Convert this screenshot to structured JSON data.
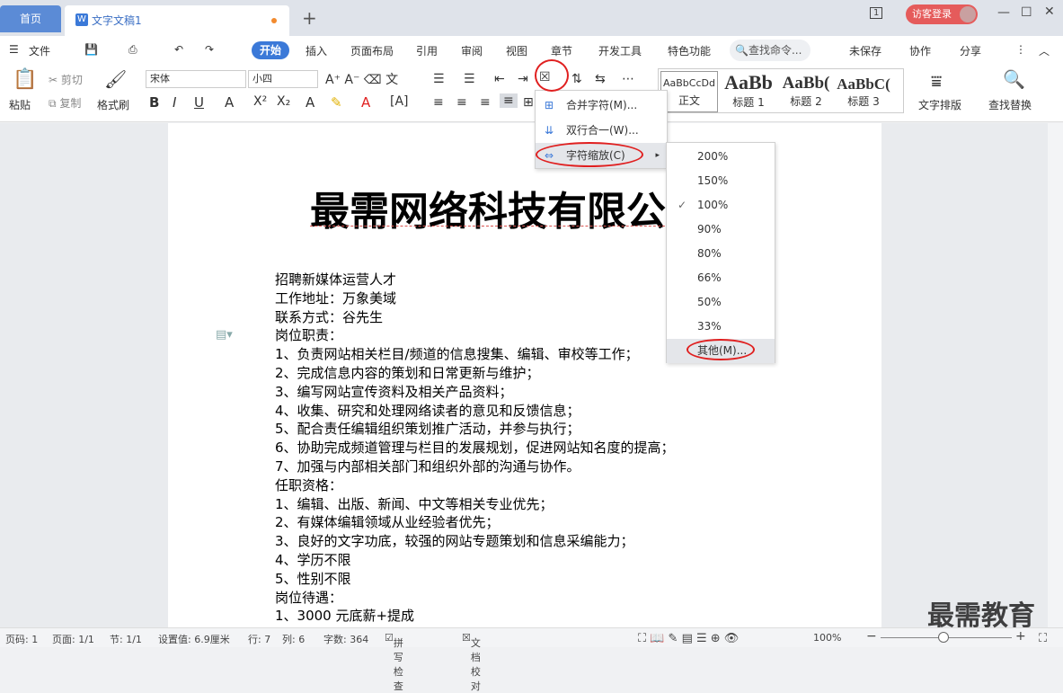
{
  "tabs": {
    "home": "首页",
    "doc": "文字文稿1",
    "new": "+"
  },
  "titlebar": {
    "login": "访客登录",
    "page_count_icon": "1"
  },
  "menu": {
    "file": "文件",
    "items": [
      "开始",
      "插入",
      "页面布局",
      "引用",
      "审阅",
      "视图",
      "章节",
      "开发工具",
      "特色功能"
    ],
    "search": "查找命令...",
    "unsaved": "未保存",
    "collab": "协作",
    "share": "分享"
  },
  "ribbon": {
    "paste": "粘贴",
    "cut": "剪切",
    "copy": "复制",
    "format_painter": "格式刷",
    "font": "宋体",
    "size": "小四",
    "text_layout": "文字排版",
    "find_replace": "查找替换",
    "styles": [
      {
        "preview": "AaBbCcDd",
        "name": "正文"
      },
      {
        "preview": "AaBb",
        "name": "标题 1"
      },
      {
        "preview": "AaBb(",
        "name": "标题 2"
      },
      {
        "preview": "AaBbC(",
        "name": "标题 3"
      }
    ]
  },
  "dropdown": {
    "items": [
      "合并字符(M)...",
      "双行合一(W)...",
      "字符缩放(C)"
    ]
  },
  "scale_menu": {
    "items": [
      "200%",
      "150%",
      "100%",
      "90%",
      "80%",
      "66%",
      "50%",
      "33%",
      "其他(M)..."
    ],
    "checked": "100%"
  },
  "document": {
    "title": "最需网络科技有限公",
    "lines": [
      "招聘新媒体运营人才",
      "工作地址：万象美域",
      "联系方式：谷先生",
      "岗位职责：",
      "1、负责网站相关栏目/频道的信息搜集、编辑、审校等工作；",
      "2、完成信息内容的策划和日常更新与维护；",
      "3、编写网站宣传资料及相关产品资料；",
      "4、收集、研究和处理网络读者的意见和反馈信息；",
      "5、配合责任编辑组织策划推广活动，并参与执行；",
      "6、协助完成频道管理与栏目的发展规划，促进网站知名度的提高；",
      "7、加强与内部相关部门和组织外部的沟通与协作。",
      "任职资格：",
      "1、编辑、出版、新闻、中文等相关专业优先；",
      "2、有媒体编辑领域从业经验者优先；",
      "3、良好的文字功底，较强的网站专题策划和信息采编能力；",
      "4、学历不限",
      "5、性别不限",
      "岗位待遇：",
      "1、3000 元底薪+提成"
    ]
  },
  "status": {
    "page_code": "页码: 1",
    "page": "页面: 1/1",
    "section": "节: 1/1",
    "setting": "设置值: 6.9厘米",
    "row": "行: 7",
    "col": "列: 6",
    "words": "字数: 364",
    "spell": "拼写检查",
    "proof": "文档校对",
    "zoom": "100%"
  },
  "watermark": "最需教育"
}
